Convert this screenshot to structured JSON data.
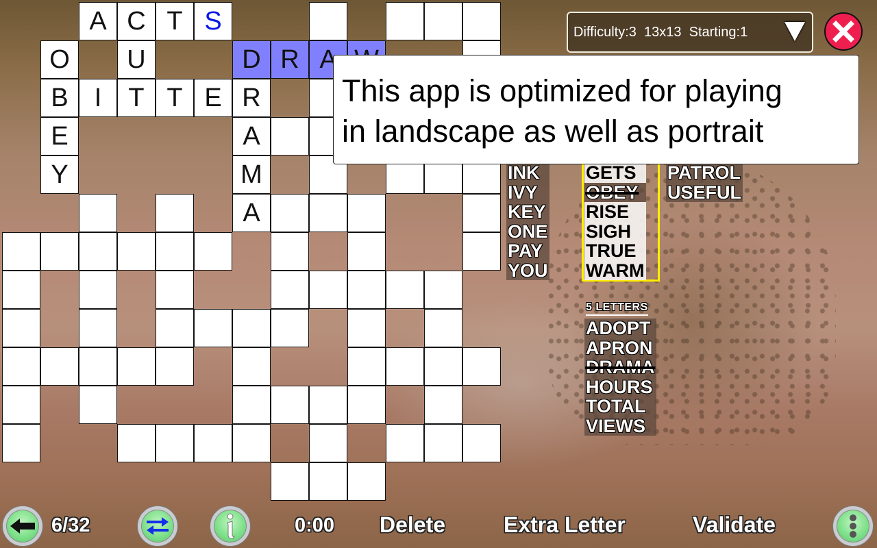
{
  "app": {
    "puzzle_info": {
      "difficulty_label": "Difficulty:3",
      "size_label": "13x13",
      "starting_label": "Starting:1",
      "display": "Difficulty:3  13x13  Starting:1"
    },
    "close_icon": "close-x-icon"
  },
  "grid": {
    "rows": 13,
    "cols": 13,
    "selected_word": "DRAW",
    "colors": {
      "cell": "#ffffff",
      "selected": "#8080ff",
      "hint_letter": "#0b17e6"
    },
    "cells": [
      {
        "r": 0,
        "c": 2,
        "ch": "A"
      },
      {
        "r": 0,
        "c": 3,
        "ch": "C"
      },
      {
        "r": 0,
        "c": 4,
        "ch": "T"
      },
      {
        "r": 0,
        "c": 5,
        "ch": "S",
        "hint": true
      },
      {
        "r": 0,
        "c": 8,
        "ch": ""
      },
      {
        "r": 0,
        "c": 10,
        "ch": ""
      },
      {
        "r": 0,
        "c": 11,
        "ch": ""
      },
      {
        "r": 0,
        "c": 12,
        "ch": ""
      },
      {
        "r": 1,
        "c": 1,
        "ch": "O"
      },
      {
        "r": 1,
        "c": 3,
        "ch": "U"
      },
      {
        "r": 1,
        "c": 6,
        "ch": "D",
        "sel": true
      },
      {
        "r": 1,
        "c": 7,
        "ch": "R",
        "sel": true
      },
      {
        "r": 1,
        "c": 8,
        "ch": "A",
        "sel": true
      },
      {
        "r": 1,
        "c": 9,
        "ch": "W",
        "sel": true
      },
      {
        "r": 1,
        "c": 12,
        "ch": ""
      },
      {
        "r": 2,
        "c": 1,
        "ch": "B"
      },
      {
        "r": 2,
        "c": 2,
        "ch": "I"
      },
      {
        "r": 2,
        "c": 3,
        "ch": "T"
      },
      {
        "r": 2,
        "c": 4,
        "ch": "T"
      },
      {
        "r": 2,
        "c": 5,
        "ch": "E"
      },
      {
        "r": 2,
        "c": 6,
        "ch": "R"
      },
      {
        "r": 2,
        "c": 8,
        "ch": ""
      },
      {
        "r": 3,
        "c": 1,
        "ch": "E"
      },
      {
        "r": 3,
        "c": 6,
        "ch": "A"
      },
      {
        "r": 3,
        "c": 7,
        "ch": ""
      },
      {
        "r": 3,
        "c": 8,
        "ch": ""
      },
      {
        "r": 4,
        "c": 1,
        "ch": "Y"
      },
      {
        "r": 4,
        "c": 6,
        "ch": "M"
      },
      {
        "r": 4,
        "c": 8,
        "ch": ""
      },
      {
        "r": 4,
        "c": 10,
        "ch": ""
      },
      {
        "r": 4,
        "c": 11,
        "ch": ""
      },
      {
        "r": 4,
        "c": 12,
        "ch": ""
      },
      {
        "r": 5,
        "c": 2,
        "ch": ""
      },
      {
        "r": 5,
        "c": 4,
        "ch": ""
      },
      {
        "r": 5,
        "c": 6,
        "ch": "A"
      },
      {
        "r": 5,
        "c": 7,
        "ch": ""
      },
      {
        "r": 5,
        "c": 8,
        "ch": ""
      },
      {
        "r": 5,
        "c": 9,
        "ch": ""
      },
      {
        "r": 5,
        "c": 12,
        "ch": ""
      },
      {
        "r": 6,
        "c": 0,
        "ch": ""
      },
      {
        "r": 6,
        "c": 1,
        "ch": ""
      },
      {
        "r": 6,
        "c": 2,
        "ch": ""
      },
      {
        "r": 6,
        "c": 3,
        "ch": ""
      },
      {
        "r": 6,
        "c": 4,
        "ch": ""
      },
      {
        "r": 6,
        "c": 5,
        "ch": ""
      },
      {
        "r": 6,
        "c": 7,
        "ch": ""
      },
      {
        "r": 6,
        "c": 9,
        "ch": ""
      },
      {
        "r": 6,
        "c": 12,
        "ch": ""
      },
      {
        "r": 7,
        "c": 0,
        "ch": ""
      },
      {
        "r": 7,
        "c": 2,
        "ch": ""
      },
      {
        "r": 7,
        "c": 4,
        "ch": ""
      },
      {
        "r": 7,
        "c": 7,
        "ch": ""
      },
      {
        "r": 7,
        "c": 8,
        "ch": ""
      },
      {
        "r": 7,
        "c": 9,
        "ch": ""
      },
      {
        "r": 7,
        "c": 10,
        "ch": ""
      },
      {
        "r": 7,
        "c": 11,
        "ch": ""
      },
      {
        "r": 8,
        "c": 0,
        "ch": ""
      },
      {
        "r": 8,
        "c": 2,
        "ch": ""
      },
      {
        "r": 8,
        "c": 4,
        "ch": ""
      },
      {
        "r": 8,
        "c": 5,
        "ch": ""
      },
      {
        "r": 8,
        "c": 6,
        "ch": ""
      },
      {
        "r": 8,
        "c": 7,
        "ch": ""
      },
      {
        "r": 8,
        "c": 9,
        "ch": ""
      },
      {
        "r": 8,
        "c": 11,
        "ch": ""
      },
      {
        "r": 9,
        "c": 0,
        "ch": ""
      },
      {
        "r": 9,
        "c": 1,
        "ch": ""
      },
      {
        "r": 9,
        "c": 2,
        "ch": ""
      },
      {
        "r": 9,
        "c": 3,
        "ch": ""
      },
      {
        "r": 9,
        "c": 4,
        "ch": ""
      },
      {
        "r": 9,
        "c": 6,
        "ch": ""
      },
      {
        "r": 9,
        "c": 9,
        "ch": ""
      },
      {
        "r": 9,
        "c": 10,
        "ch": ""
      },
      {
        "r": 9,
        "c": 11,
        "ch": ""
      },
      {
        "r": 9,
        "c": 12,
        "ch": ""
      },
      {
        "r": 10,
        "c": 0,
        "ch": ""
      },
      {
        "r": 10,
        "c": 2,
        "ch": ""
      },
      {
        "r": 10,
        "c": 6,
        "ch": ""
      },
      {
        "r": 10,
        "c": 7,
        "ch": ""
      },
      {
        "r": 10,
        "c": 8,
        "ch": ""
      },
      {
        "r": 10,
        "c": 9,
        "ch": ""
      },
      {
        "r": 10,
        "c": 11,
        "ch": ""
      },
      {
        "r": 11,
        "c": 0,
        "ch": ""
      },
      {
        "r": 11,
        "c": 3,
        "ch": ""
      },
      {
        "r": 11,
        "c": 4,
        "ch": ""
      },
      {
        "r": 11,
        "c": 5,
        "ch": ""
      },
      {
        "r": 11,
        "c": 6,
        "ch": ""
      },
      {
        "r": 11,
        "c": 8,
        "ch": ""
      },
      {
        "r": 11,
        "c": 10,
        "ch": ""
      },
      {
        "r": 11,
        "c": 11,
        "ch": ""
      },
      {
        "r": 11,
        "c": 12,
        "ch": ""
      },
      {
        "r": 12,
        "c": 7,
        "ch": ""
      },
      {
        "r": 12,
        "c": 8,
        "ch": ""
      },
      {
        "r": 12,
        "c": 9,
        "ch": ""
      }
    ]
  },
  "dialog": {
    "line1": "This app is optimized for playing",
    "line2": "in landscape as well as portrait"
  },
  "word_list": {
    "three_letters": [
      {
        "word": "INK",
        "done": false
      },
      {
        "word": "IVY",
        "done": false
      },
      {
        "word": "KEY",
        "done": false
      },
      {
        "word": "ONE",
        "done": false
      },
      {
        "word": "PAY",
        "done": false
      },
      {
        "word": "YOU",
        "done": false
      }
    ],
    "four_letters": [
      {
        "word": "GETS",
        "done": false
      },
      {
        "word": "OBEY",
        "done": true
      },
      {
        "word": "RISE",
        "done": false
      },
      {
        "word": "SIGH",
        "done": false
      },
      {
        "word": "TRUE",
        "done": false
      },
      {
        "word": "WARM",
        "done": false
      }
    ],
    "six_letters": [
      {
        "word": "PATROL",
        "done": false
      },
      {
        "word": "USEFUL",
        "done": false
      }
    ],
    "five_letters_heading": "5 LETTERS",
    "five_letters": [
      {
        "word": "ADOPT",
        "done": false
      },
      {
        "word": "APRON",
        "done": false
      },
      {
        "word": "DRAMA",
        "done": true
      },
      {
        "word": "HOURS",
        "done": false
      },
      {
        "word": "TOTAL",
        "done": false
      },
      {
        "word": "VIEWS",
        "done": false
      }
    ],
    "highlight_color": "#ffee00"
  },
  "toolbar": {
    "back_icon": "arrow-left-icon",
    "progress": "6/32",
    "swap_icon": "swap-arrows-icon",
    "info_icon": "info-icon",
    "timer": "0:00",
    "delete_label": "Delete",
    "extra_letter_label": "Extra Letter",
    "validate_label": "Validate",
    "menu_icon": "more-vertical-icon"
  }
}
